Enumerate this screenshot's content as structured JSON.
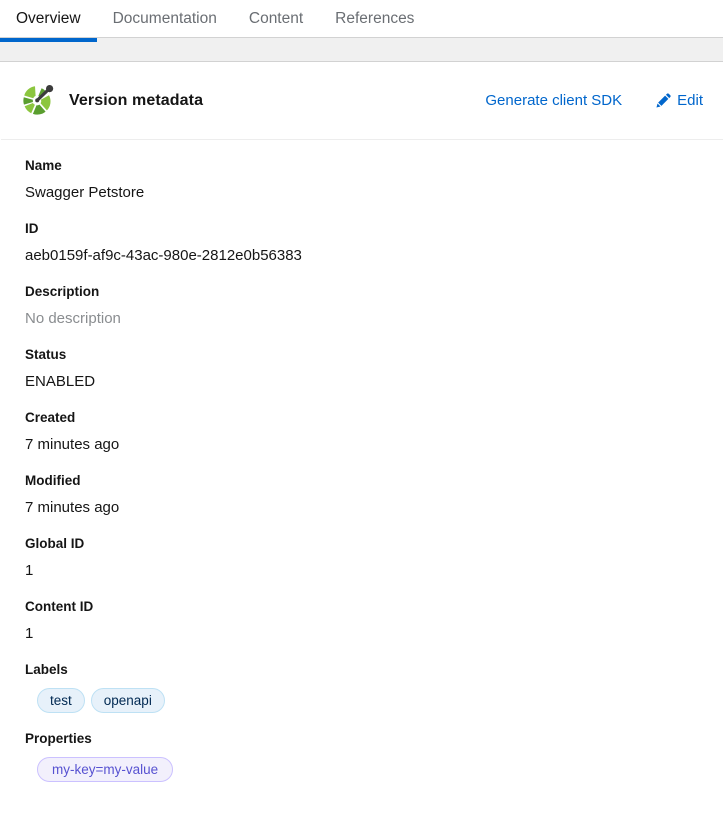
{
  "tabs": [
    {
      "label": "Overview",
      "active": true
    },
    {
      "label": "Documentation",
      "active": false
    },
    {
      "label": "Content",
      "active": false
    },
    {
      "label": "References",
      "active": false
    }
  ],
  "card": {
    "icon": "openapi-logo-icon",
    "title": "Version metadata",
    "actions": {
      "generate_sdk_label": "Generate client SDK",
      "edit_label": "Edit",
      "edit_icon": "pencil-icon"
    }
  },
  "fields": [
    {
      "label": "Name",
      "value": "Swagger Petstore",
      "muted": false
    },
    {
      "label": "ID",
      "value": "aeb0159f-af9c-43ac-980e-2812e0b56383",
      "muted": false
    },
    {
      "label": "Description",
      "value": "No description",
      "muted": true
    },
    {
      "label": "Status",
      "value": "ENABLED",
      "muted": false
    },
    {
      "label": "Created",
      "value": "7 minutes ago",
      "muted": false
    },
    {
      "label": "Modified",
      "value": "7 minutes ago",
      "muted": false
    },
    {
      "label": "Global ID",
      "value": "1",
      "muted": false
    },
    {
      "label": "Content ID",
      "value": "1",
      "muted": false
    }
  ],
  "labels_section": {
    "label": "Labels",
    "chips": [
      "test",
      "openapi"
    ]
  },
  "properties_section": {
    "label": "Properties",
    "chips": [
      "my-key=my-value"
    ]
  },
  "colors": {
    "accent_blue": "#0066cc",
    "tab_inactive": "#6a6e73",
    "text": "#151515",
    "muted_text": "#8a8d90",
    "gap_band": "#f0f0f0",
    "label_chip_bg": "#e7f1fa",
    "label_chip_border": "#bee1f4",
    "label_chip_text": "#002952",
    "property_chip_bg": "#f2f0fc",
    "property_chip_border": "#cbc1ff",
    "property_chip_text": "#5752d1",
    "logo_green": "#8cc63f",
    "logo_dark": "#3c3c3c"
  }
}
